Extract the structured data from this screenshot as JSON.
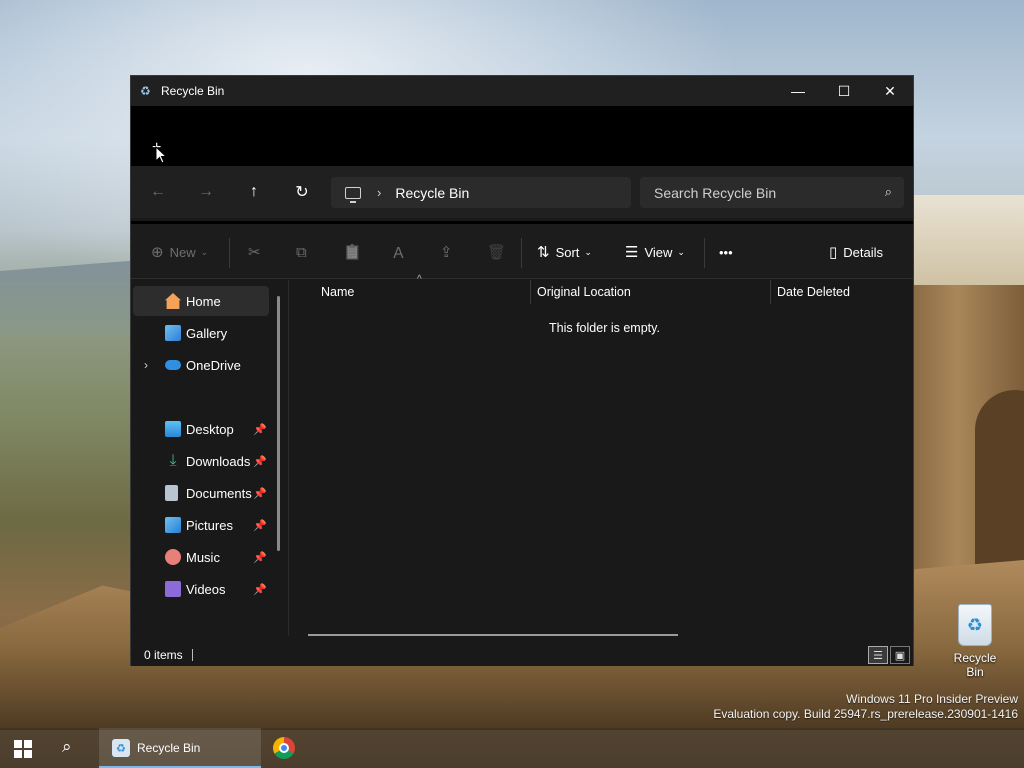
{
  "window": {
    "title": "Recycle Bin",
    "controls": {
      "minimize": "—",
      "maximize": "☐",
      "close": "✕"
    }
  },
  "tabstrip": {
    "new_tab": "+"
  },
  "nav": {
    "back": "←",
    "forward": "→",
    "up": "↑",
    "refresh": "↻",
    "chevron": "›",
    "address": "Recycle Bin",
    "search_placeholder": "Search Recycle Bin",
    "search_icon": "⌕"
  },
  "toolbar": {
    "new_label": "New",
    "sort_label": "Sort",
    "view_label": "View",
    "more_label": "•••",
    "details_label": "Details",
    "icons": {
      "new": "⊕",
      "cut": "✂",
      "copy": "⧉",
      "paste": "📋",
      "rename": "Ａ",
      "share": "⇪",
      "delete": "🗑",
      "sort": "⇅",
      "view": "☰",
      "details": "▯",
      "caret": "⌄"
    }
  },
  "sidebar": {
    "items": [
      {
        "label": "Home",
        "selected": true,
        "icon": "home-icon",
        "color": "#f3a25a"
      },
      {
        "label": "Gallery",
        "icon": "gallery-icon",
        "color": "#4aa3e8"
      },
      {
        "label": "OneDrive",
        "icon": "onedrive-icon",
        "color": "#2f8fe0",
        "expandable": true,
        "expand": "›"
      },
      {
        "label": "Desktop",
        "icon": "desktop-icon",
        "color": "#3fa4e6",
        "pinned": true
      },
      {
        "label": "Downloads",
        "icon": "downloads-icon",
        "color": "#3fb37f",
        "pinned": true
      },
      {
        "label": "Documents",
        "icon": "documents-icon",
        "color": "#9aa7b8",
        "pinned": true
      },
      {
        "label": "Pictures",
        "icon": "pictures-icon",
        "color": "#4aa3e8",
        "pinned": true
      },
      {
        "label": "Music",
        "icon": "music-icon",
        "color": "#e86a6a",
        "pinned": true
      },
      {
        "label": "Videos",
        "icon": "videos-icon",
        "color": "#8e6ad8",
        "pinned": true
      }
    ],
    "pin_glyph": "📌"
  },
  "content": {
    "columns": [
      "Name",
      "Original Location",
      "Date Deleted"
    ],
    "sort_arrow": "^",
    "empty_message": "This folder is empty."
  },
  "status": {
    "items": "0 items"
  },
  "desktop": {
    "icon_label": "Recycle Bin",
    "watermark_line1": "Windows 11 Pro Insider Preview",
    "watermark_line2": "Evaluation copy. Build 25947.rs_prerelease.230901-1416"
  },
  "taskbar": {
    "app_label": "Recycle Bin"
  }
}
